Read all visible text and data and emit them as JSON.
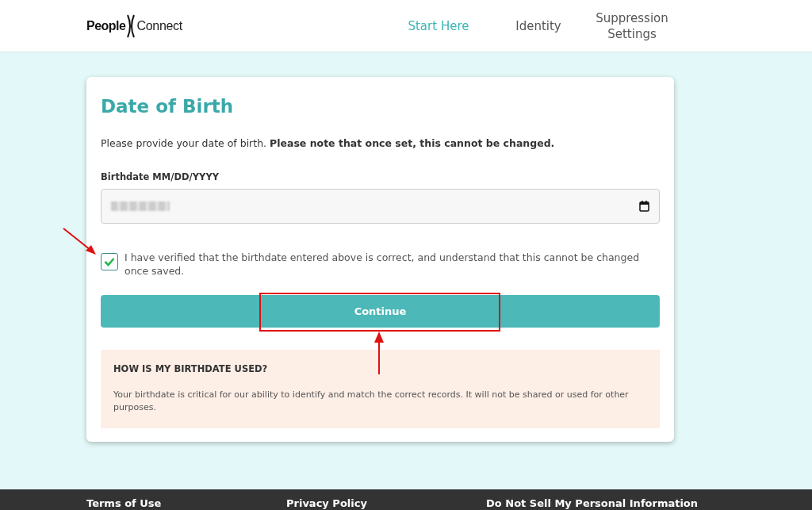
{
  "header": {
    "logo": {
      "left": "People",
      "right": "Connect"
    },
    "nav": [
      {
        "label": "Start Here",
        "selected": true
      },
      {
        "label": "Identity",
        "selected": false
      },
      {
        "label": "Suppression Settings",
        "selected": false
      }
    ]
  },
  "card": {
    "title": "Date of Birth",
    "intro": "Please provide your date of birth. **Please note that once set, this cannot be changed.**",
    "field_label": "Birthdate MM/DD/YYYY",
    "confirm": {
      "label": "I have verified that the birthdate entered above is correct, and understand that this cannot be changed once saved.",
      "checked": true
    },
    "button": "Continue",
    "info": {
      "heading": "HOW IS MY BIRTHDATE USED?",
      "text": "Your birthdate is critical for our ability to identify and match the correct records. It will not be shared or used for other purposes."
    }
  },
  "footer": {
    "links": [
      "Terms of Use",
      "Privacy Policy",
      "Do Not Sell My Personal Information"
    ]
  }
}
